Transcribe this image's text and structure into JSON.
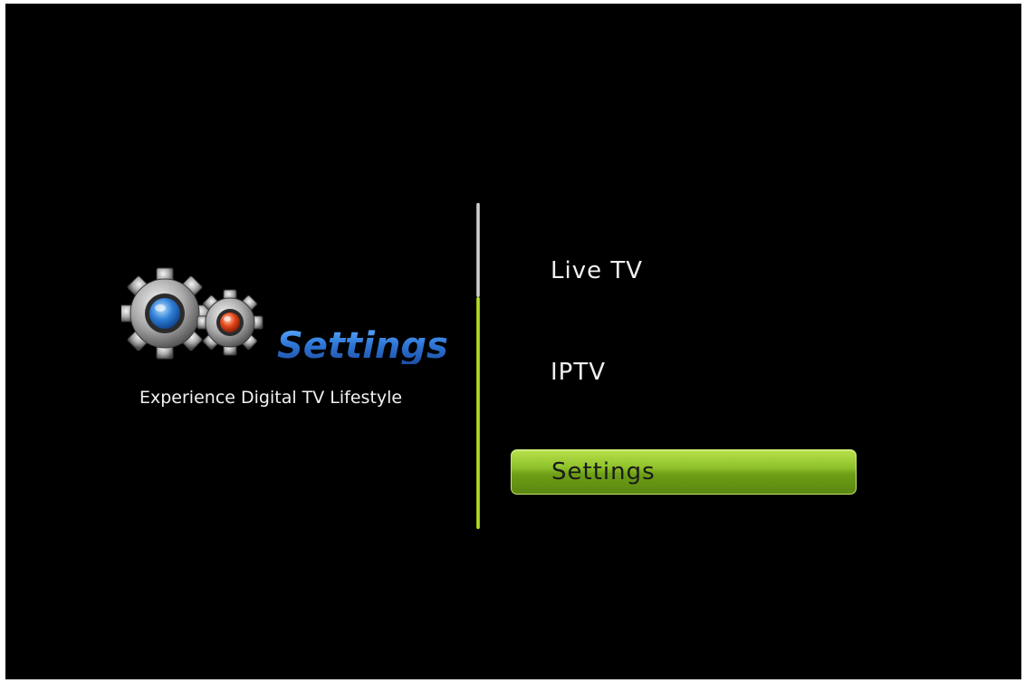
{
  "brand": {
    "title": "Settings",
    "tagline": "Experience Digital TV Lifestyle",
    "logo_icon": "gears-icon"
  },
  "menu": {
    "items": [
      {
        "label": "Live TV",
        "selected": false
      },
      {
        "label": "IPTV",
        "selected": false
      },
      {
        "label": "Settings",
        "selected": true
      }
    ],
    "scroll_position": 0.29
  },
  "colors": {
    "background": "#000000",
    "accent_green": "#8fc22b",
    "title_blue": "#2f77d6",
    "text": "#f0f0f0"
  }
}
